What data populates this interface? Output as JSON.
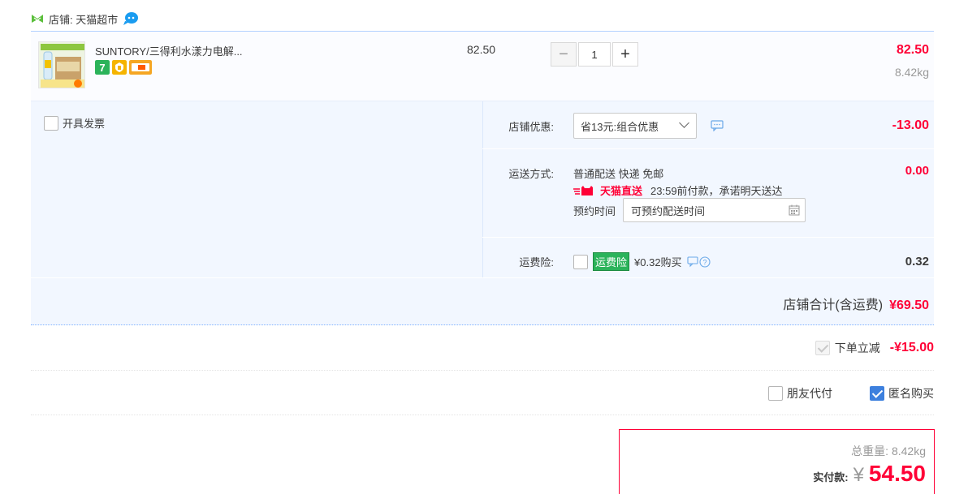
{
  "store": {
    "label": "店铺: 天猫超市",
    "shop_icon": "tmall-cat-icon",
    "chat_icon": "wangwang-chat-icon"
  },
  "item": {
    "title": "SUNTORY/三得利水漾力电解...",
    "unit_price": "82.50",
    "quantity": "1",
    "minus_label": "−",
    "plus_label": "+",
    "subtotal": "82.50",
    "weight": "8.42kg",
    "service_icons": [
      "seven-day-return-icon",
      "quality-assurance-icon",
      "payment-card-icon"
    ]
  },
  "invoice": {
    "label": "开具发票"
  },
  "store_discount": {
    "label": "店铺优惠:",
    "selected": "省13元:组合优惠",
    "amount": "-13.00"
  },
  "shipping": {
    "label": "运送方式:",
    "method": "普通配送 快递 免邮",
    "badge": "天猫直送",
    "promise": "23:59前付款，承诺明天送达",
    "appointment_label": "预约时间",
    "appointment_placeholder": "可预约配送时间",
    "amount": "0.00"
  },
  "insurance": {
    "label": "运费险:",
    "tag": "运费险",
    "price_text": "¥0.32购买",
    "amount": "0.32"
  },
  "store_total": {
    "label": "店铺合计(含运费)",
    "amount": "¥69.50"
  },
  "order_discount": {
    "label": "下单立减",
    "amount": "-¥15.00"
  },
  "pay_options": {
    "friend_pay": "朋友代付",
    "anonymous": "匿名购买"
  },
  "summary": {
    "weight_label": "总重量:",
    "weight": "8.42kg",
    "pay_label": "实付款:",
    "currency": "¥",
    "amount": "54.50"
  },
  "colors": {
    "accent_red": "#ff0036",
    "blue_panel": "#f2f7ff",
    "check_blue": "#3d80de",
    "insurance_green": "#2bb35a"
  }
}
